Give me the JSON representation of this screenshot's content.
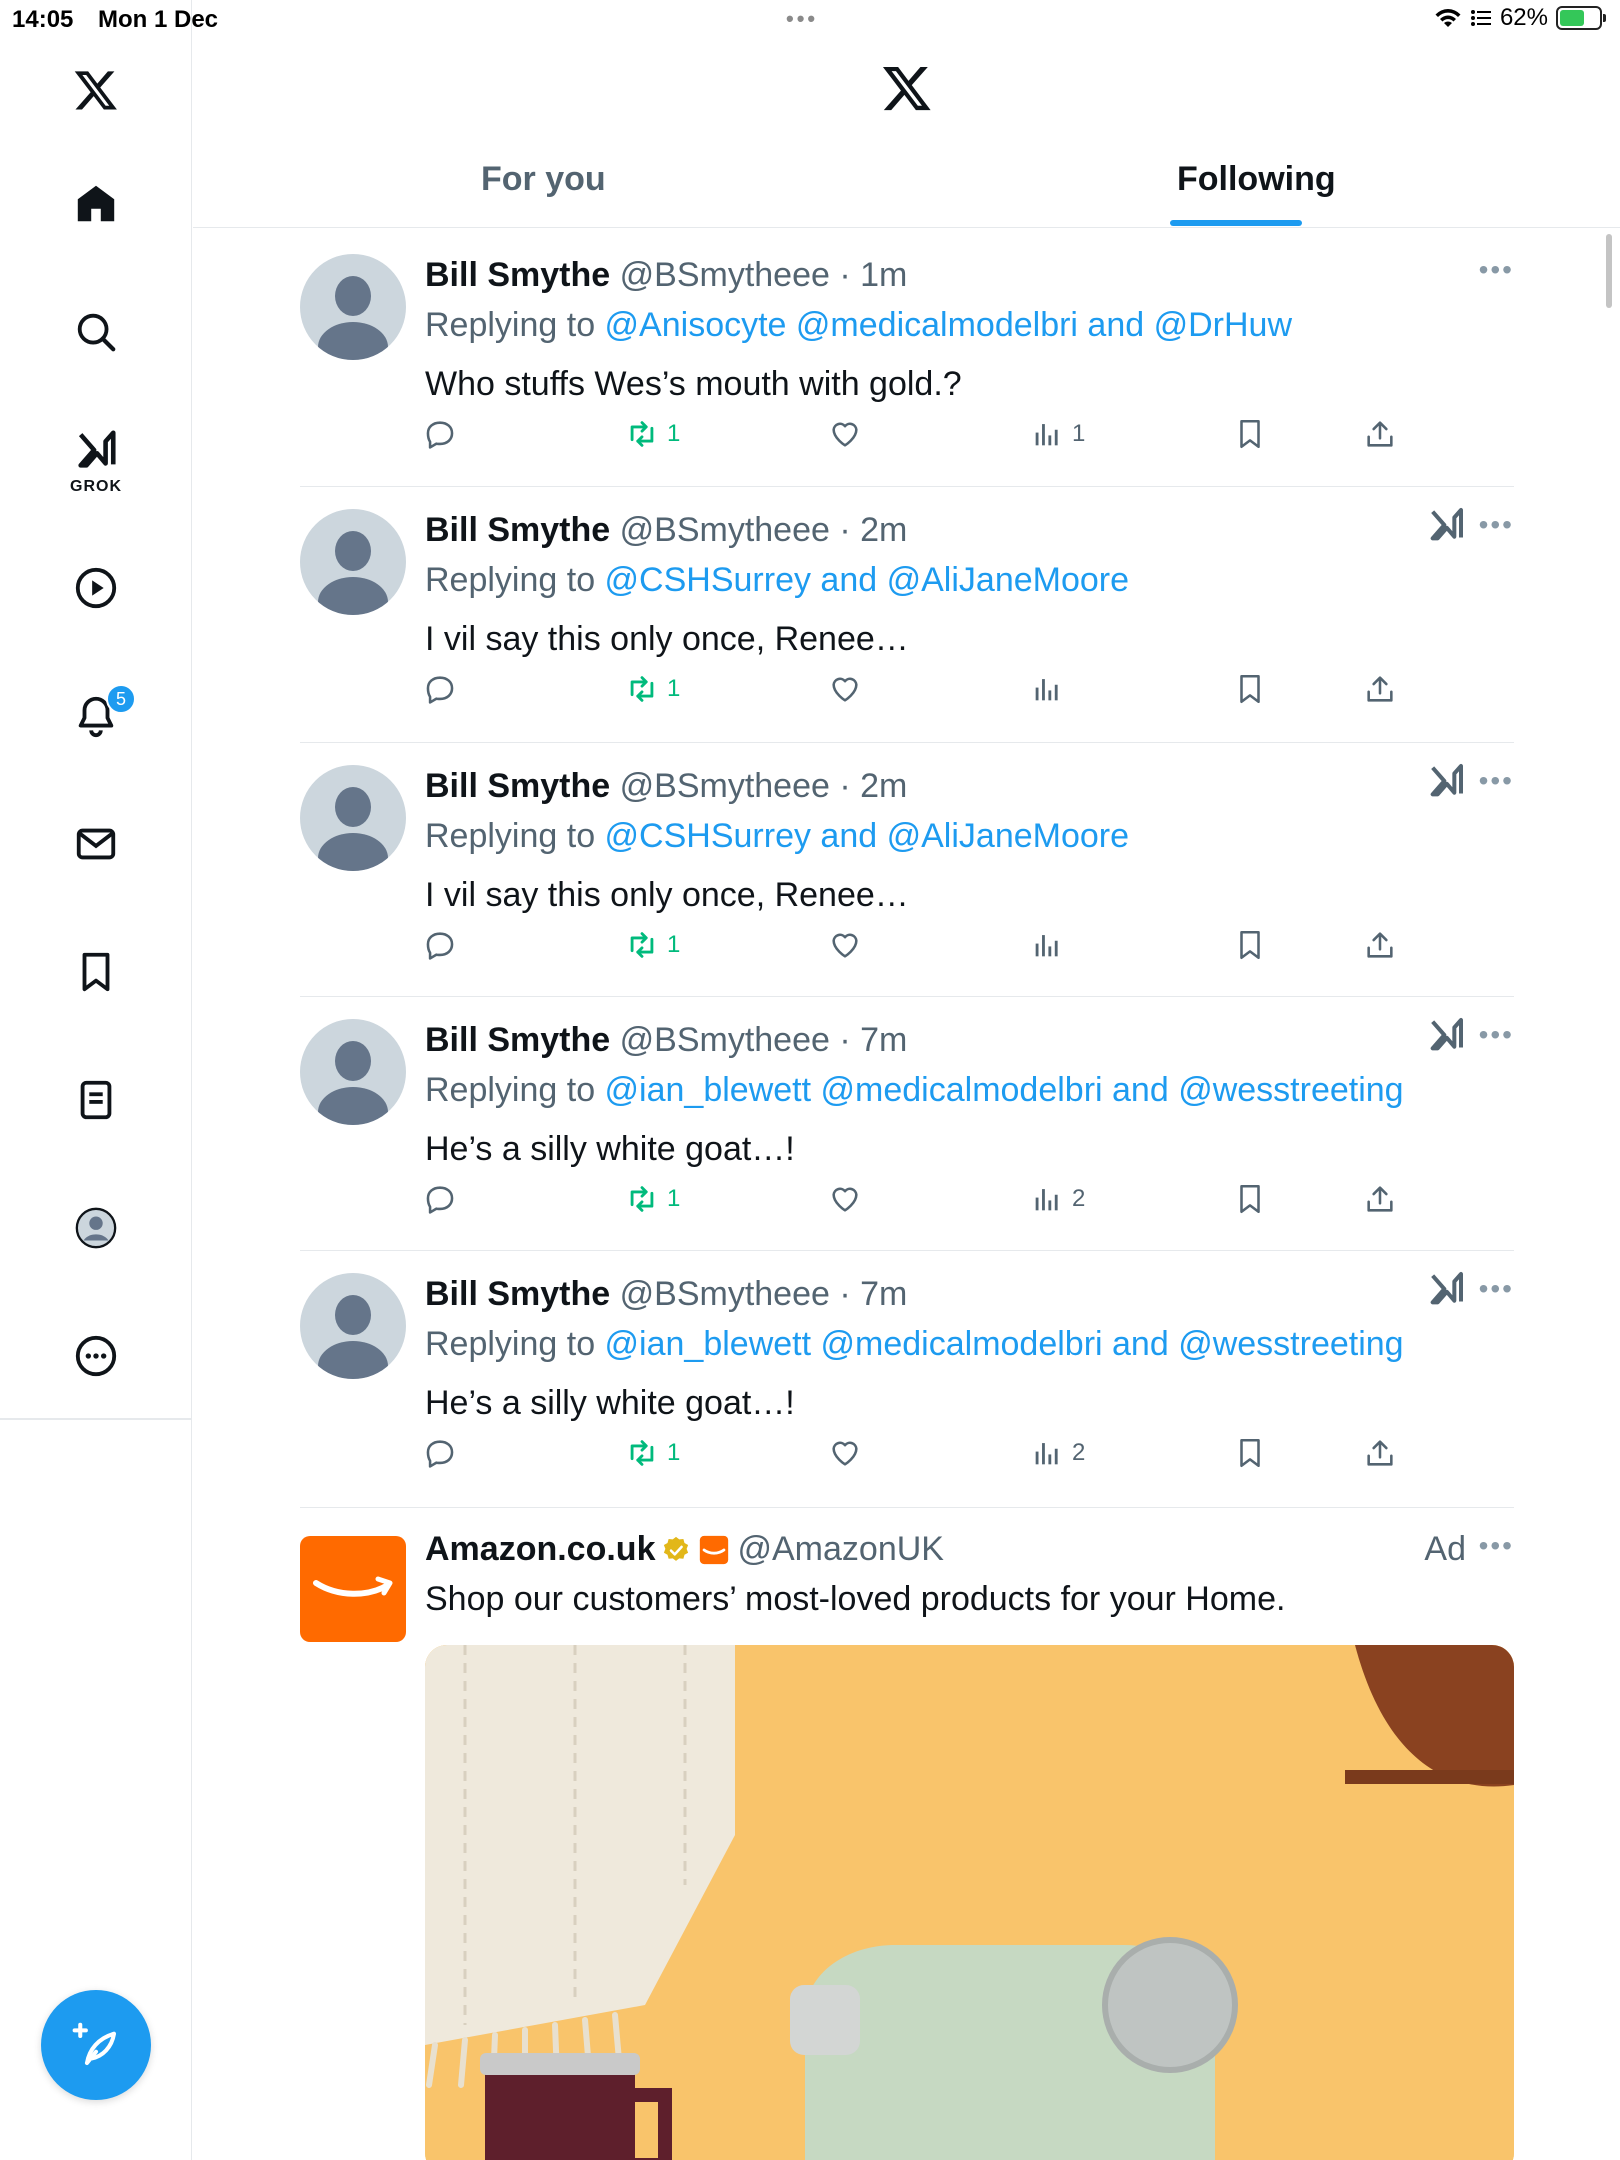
{
  "status_bar": {
    "time": "14:05",
    "date": "Mon 1 Dec",
    "battery": "62%",
    "battery_level": 0.62
  },
  "header": {
    "tabs": [
      {
        "label": "For you",
        "selected": false
      },
      {
        "label": "Following",
        "selected": true
      }
    ]
  },
  "sidebar": {
    "items": [
      "home-icon",
      "search-icon",
      "grok-icon",
      "video-icon",
      "notifications-icon",
      "messages-icon",
      "bookmarks-icon",
      "lists-icon",
      "profile-icon",
      "more-icon"
    ],
    "grok_label": "GROK",
    "notification_count": "5"
  },
  "tweets": [
    {
      "name": "Bill Smythe",
      "handle": "@BSmytheee",
      "time": "· 1m",
      "replying_prefix": "Replying to ",
      "mentions": "@Anisocyte @medicalmodelbri and @DrHuw",
      "text": "Who stuffs Wes’s mouth with gold.?",
      "retweets": "1",
      "views": "1",
      "show_grok": false
    },
    {
      "name": "Bill Smythe",
      "handle": "@BSmytheee",
      "time": "· 2m",
      "replying_prefix": "Replying to ",
      "mentions": "@CSHSurrey and @AliJaneMoore",
      "text": "I vil say this only once, Renee…",
      "retweets": "1",
      "views": "",
      "show_grok": true
    },
    {
      "name": "Bill Smythe",
      "handle": "@BSmytheee",
      "time": "· 2m",
      "replying_prefix": "Replying to ",
      "mentions": "@CSHSurrey and @AliJaneMoore",
      "text": "I vil say this only once, Renee…",
      "retweets": "1",
      "views": "",
      "show_grok": true
    },
    {
      "name": "Bill Smythe",
      "handle": "@BSmytheee",
      "time": "· 7m",
      "replying_prefix": "Replying to ",
      "mentions": "@ian_blewett @medicalmodelbri and @wesstreeting",
      "text": "He’s a silly white goat…!",
      "retweets": "1",
      "views": "2",
      "show_grok": true
    },
    {
      "name": "Bill Smythe",
      "handle": "@BSmytheee",
      "time": "· 7m",
      "replying_prefix": "Replying to ",
      "mentions": "@ian_blewett @medicalmodelbri and @wesstreeting",
      "text": "He’s a silly white goat…!",
      "retweets": "1",
      "views": "2",
      "show_grok": true
    }
  ],
  "ad": {
    "name": "Amazon.co.uk",
    "handle": "@AmazonUK",
    "label": "Ad",
    "text": "Shop our customers’ most-loved products for your Home."
  },
  "colors": {
    "accent": "#1d9bf0",
    "retweet": "#00ba7c",
    "muted": "#536471",
    "divider": "#e6e9ec",
    "amazon": "#ff6a00",
    "ad_background": "#f9c46b"
  }
}
